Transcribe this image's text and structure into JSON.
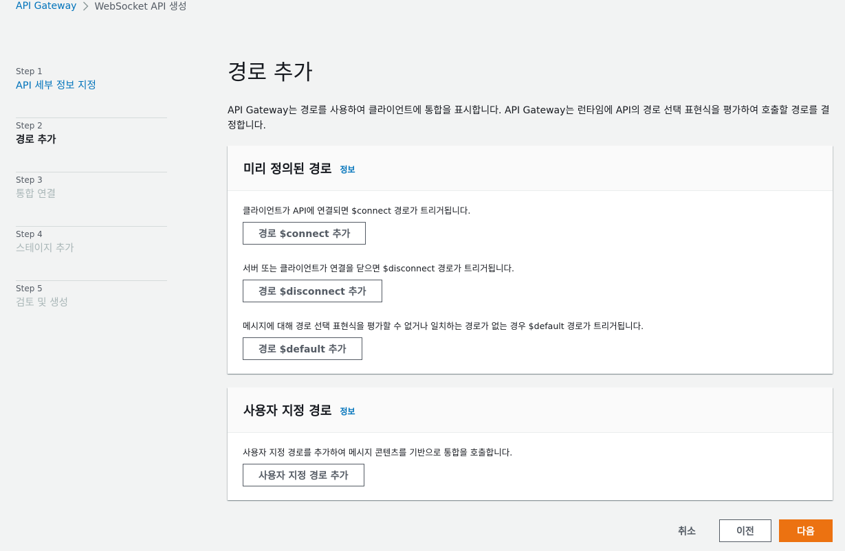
{
  "breadcrumb": {
    "root": "API Gateway",
    "current": "WebSocket API 생성"
  },
  "steps": [
    {
      "num": "Step 1",
      "title": "API 세부 정보 지정",
      "state": "link"
    },
    {
      "num": "Step 2",
      "title": "경로 추가",
      "state": "active"
    },
    {
      "num": "Step 3",
      "title": "통합 연결",
      "state": "disabled"
    },
    {
      "num": "Step 4",
      "title": "스테이지 추가",
      "state": "disabled"
    },
    {
      "num": "Step 5",
      "title": "검토 및 생성",
      "state": "disabled"
    }
  ],
  "page": {
    "title": "경로 추가",
    "description": "API Gateway는 경로를 사용하여 클라이언트에 통합을 표시합니다. API Gateway는 런타임에 API의 경로 선택 표현식을 평가하여 호출할 경로를 결정합니다."
  },
  "predefined": {
    "title": "미리 정의된 경로",
    "info": "정보",
    "connect_desc": "클라이언트가 API에 연결되면 $connect 경로가 트리거됩니다.",
    "connect_btn": "경로 $connect 추가",
    "disconnect_desc": "서버 또는 클라이언트가 연결을 닫으면 $disconnect 경로가 트리거됩니다.",
    "disconnect_btn": "경로 $disconnect 추가",
    "default_desc": "메시지에 대해 경로 선택 표현식을 평가할 수 없거나 일치하는 경로가 없는 경우 $default 경로가 트리거됩니다.",
    "default_btn": "경로 $default 추가"
  },
  "custom": {
    "title": "사용자 지정 경로",
    "info": "정보",
    "desc": "사용자 지정 경로를 추가하여 메시지 콘텐츠를 기반으로 통합을 호출합니다.",
    "btn": "사용자 지정 경로 추가"
  },
  "footer": {
    "cancel": "취소",
    "previous": "이전",
    "next": "다음"
  },
  "colors": {
    "link": "#0073bb",
    "primary": "#ec7211",
    "background": "#f2f3f3"
  }
}
